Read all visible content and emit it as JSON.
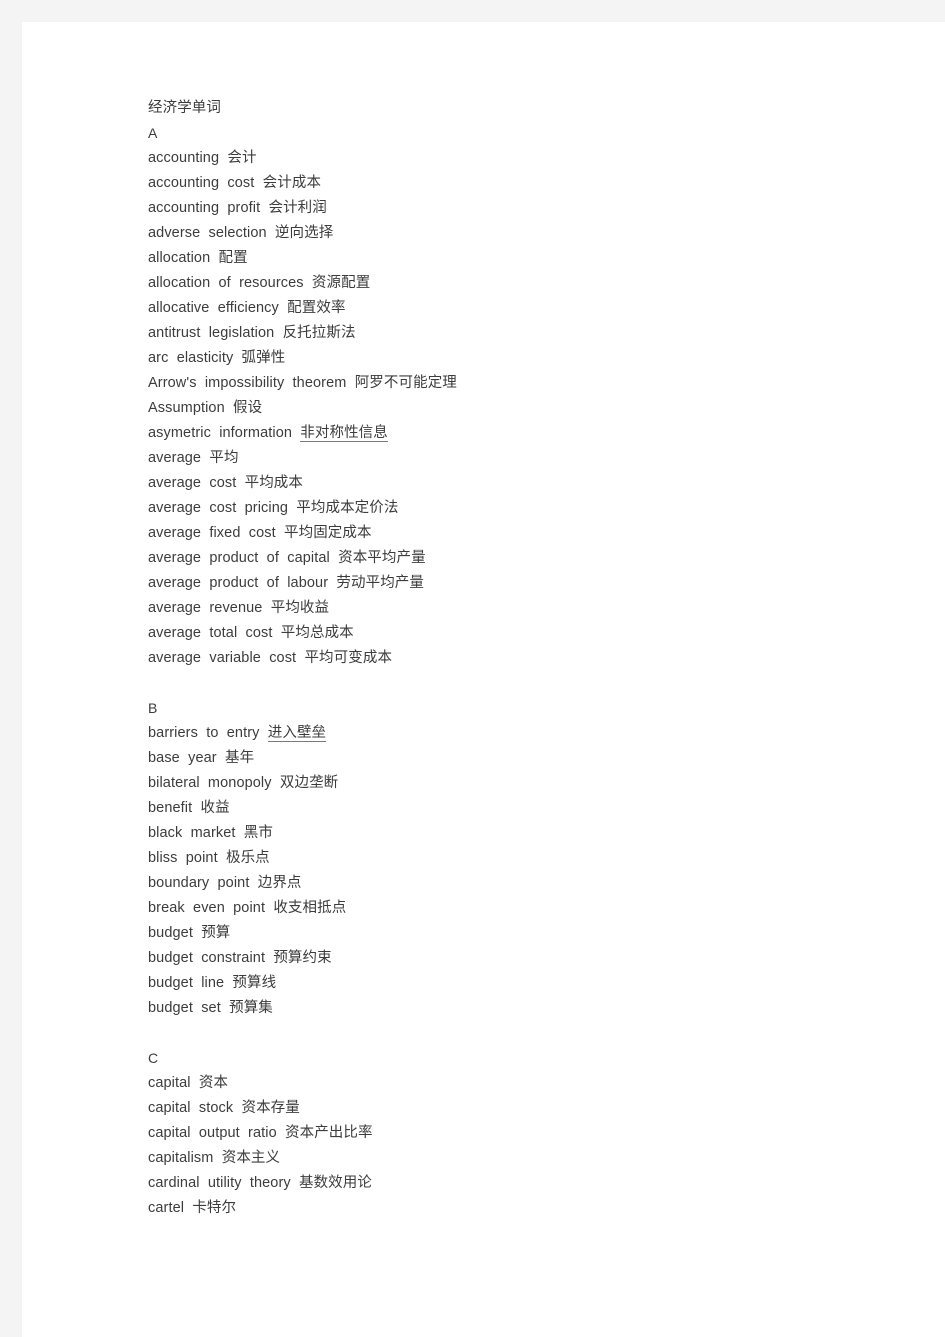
{
  "document": {
    "title": "经济学单词",
    "lines": [
      {
        "id": "title",
        "text": "经济学单词",
        "type": "title"
      },
      {
        "id": "section-a",
        "text": "A",
        "type": "section"
      },
      {
        "id": "accounting",
        "text": "accounting  会计",
        "type": "entry"
      },
      {
        "id": "accounting-cost",
        "text": "accounting  cost  会计成本",
        "type": "entry"
      },
      {
        "id": "accounting-profit",
        "text": "accounting  profit  会计利润",
        "type": "entry"
      },
      {
        "id": "adverse-selection",
        "text": "adverse  selection  逆向选择",
        "type": "entry"
      },
      {
        "id": "allocation",
        "text": "allocation  配置",
        "type": "entry"
      },
      {
        "id": "allocation-of-resources",
        "text": "allocation  of  resources  资源配置",
        "type": "entry"
      },
      {
        "id": "allocative-efficiency",
        "text": "allocative  efficiency  配置效率",
        "type": "entry"
      },
      {
        "id": "antitrust-legislation",
        "text": "antitrust  legislation  反托拉斯法",
        "type": "entry"
      },
      {
        "id": "arc-elasticity",
        "text": "arc  elasticity  弧弹性",
        "type": "entry"
      },
      {
        "id": "arrows-impossibility",
        "text": "Arrow's  impossibility  theorem  阿罗不可能定理",
        "type": "entry"
      },
      {
        "id": "assumption",
        "text": "Assumption  假设",
        "type": "entry"
      },
      {
        "id": "asymetric-information",
        "text": "asymetric  information  非对称性信息",
        "type": "entry",
        "underline": true
      },
      {
        "id": "average",
        "text": "average  平均",
        "type": "entry"
      },
      {
        "id": "average-cost",
        "text": "average  cost  平均成本",
        "type": "entry"
      },
      {
        "id": "average-cost-pricing",
        "text": "average  cost  pricing  平均成本定价法",
        "type": "entry"
      },
      {
        "id": "average-fixed-cost",
        "text": "average  fixed  cost  平均固定成本",
        "type": "entry"
      },
      {
        "id": "average-product-capital",
        "text": "average  product  of  capital  资本平均产量",
        "type": "entry"
      },
      {
        "id": "average-product-labour",
        "text": "average  product  of  labour  劳动平均产量",
        "type": "entry"
      },
      {
        "id": "average-revenue",
        "text": "average  revenue  平均收益",
        "type": "entry"
      },
      {
        "id": "average-total-cost",
        "text": "average  total  cost  平均总成本",
        "type": "entry"
      },
      {
        "id": "average-variable-cost",
        "text": "average  variable  cost  平均可变成本",
        "type": "entry"
      },
      {
        "id": "blank-1",
        "text": "",
        "type": "blank"
      },
      {
        "id": "section-b",
        "text": "B",
        "type": "section"
      },
      {
        "id": "barriers-to-entry",
        "text": "barriers  to  entry  进入壁垒",
        "type": "entry",
        "underline": true
      },
      {
        "id": "base-year",
        "text": "base  year  基年",
        "type": "entry"
      },
      {
        "id": "bilateral-monopoly",
        "text": "bilateral  monopoly  双边垄断",
        "type": "entry"
      },
      {
        "id": "benefit",
        "text": "benefit  收益",
        "type": "entry"
      },
      {
        "id": "black-market",
        "text": "black  market  黑市",
        "type": "entry"
      },
      {
        "id": "bliss-point",
        "text": "bliss  point  极乐点",
        "type": "entry"
      },
      {
        "id": "boundary-point",
        "text": "boundary  point  边界点",
        "type": "entry"
      },
      {
        "id": "break-even-point",
        "text": "break  even  point  收支相抵点",
        "type": "entry"
      },
      {
        "id": "budget",
        "text": "budget  预算",
        "type": "entry"
      },
      {
        "id": "budget-constraint",
        "text": "budget  constraint  预算约束",
        "type": "entry"
      },
      {
        "id": "budget-line",
        "text": "budget  line  预算线",
        "type": "entry"
      },
      {
        "id": "budget-set",
        "text": "budget  set  预算集",
        "type": "entry"
      },
      {
        "id": "blank-2",
        "text": "",
        "type": "blank"
      },
      {
        "id": "section-c",
        "text": "C",
        "type": "section"
      },
      {
        "id": "capital",
        "text": "capital  资本",
        "type": "entry"
      },
      {
        "id": "capital-stock",
        "text": "capital  stock  资本存量",
        "type": "entry"
      },
      {
        "id": "capital-output-ratio",
        "text": "capital  output  ratio  资本产出比率",
        "type": "entry"
      },
      {
        "id": "capitalism",
        "text": "capitalism  资本主义",
        "type": "entry"
      },
      {
        "id": "cardinal-utility-theory",
        "text": "cardinal  utility  theory  基数效用论",
        "type": "entry"
      },
      {
        "id": "cartel",
        "text": "cartel  卡特尔",
        "type": "entry"
      }
    ]
  },
  "style": {
    "page_background": "#ffffff",
    "margin_band_color": "#f4f4f4",
    "text_color": "#3c3c3c"
  }
}
